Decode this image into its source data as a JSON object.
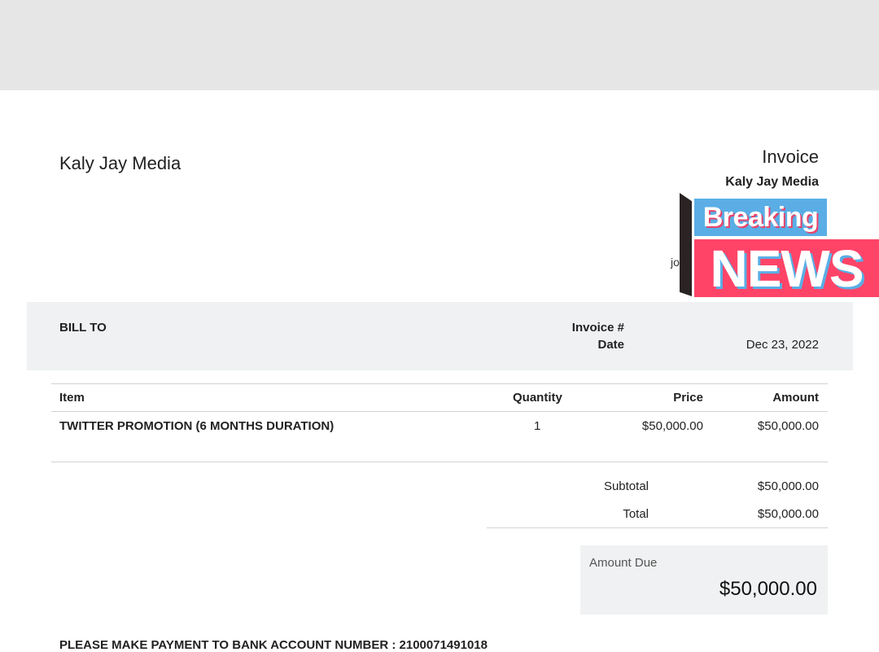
{
  "header": {
    "company_name": "Kaly Jay Media",
    "invoice_title": "Invoice",
    "invoice_company": "Kaly Jay Media",
    "email_fragment": "jo"
  },
  "billing": {
    "bill_to_label": "BILL TO",
    "invoice_number_label": "Invoice #",
    "invoice_number_value": "",
    "date_label": "Date",
    "date_value": "Dec 23, 2022"
  },
  "items_table": {
    "columns": [
      "Item",
      "Quantity",
      "Price",
      "Amount"
    ],
    "rows": [
      {
        "item": "TWITTER PROMOTION (6 MONTHS DURATION)",
        "quantity": "1",
        "price": "$50,000.00",
        "amount": "$50,000.00"
      }
    ]
  },
  "totals": {
    "subtotal_label": "Subtotal",
    "subtotal_value": "$50,000.00",
    "total_label": "Total",
    "total_value": "$50,000.00",
    "amount_due_label": "Amount Due",
    "amount_due_value": "$50,000.00"
  },
  "payment_note": "PLEASE MAKE PAYMENT TO BANK ACCOUNT NUMBER : 2100071491018",
  "badge": {
    "line1": "Breaking",
    "line2": "NEWS",
    "colors": {
      "blue": "#5aaee5",
      "pink": "#ff4468",
      "dark": "#2a2323"
    }
  },
  "colors": {
    "top_bar": "#e6e6e6",
    "band": "#eff1f2"
  }
}
